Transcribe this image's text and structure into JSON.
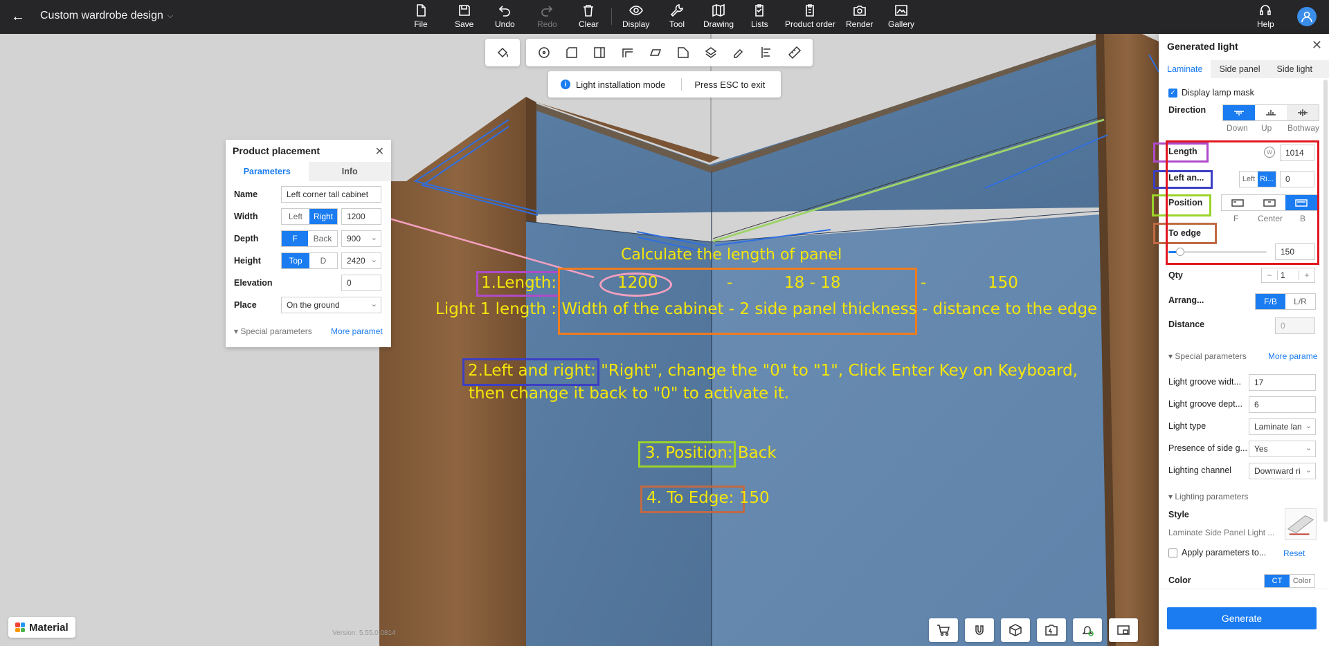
{
  "topbar": {
    "title": "Custom wardrobe design",
    "tools": [
      {
        "label": "File"
      },
      {
        "label": "Save"
      },
      {
        "label": "Undo"
      },
      {
        "label": "Redo"
      },
      {
        "label": "Clear"
      },
      {
        "label": "Display"
      },
      {
        "label": "Tool"
      },
      {
        "label": "Drawing"
      },
      {
        "label": "Lists"
      },
      {
        "label": "Product order"
      },
      {
        "label": "Render"
      },
      {
        "label": "Gallery"
      }
    ],
    "help": "Help"
  },
  "banner": {
    "mode": "Light installation mode",
    "exit": "Press ESC to exit"
  },
  "annotations": {
    "heading": "Calculate the length of panel",
    "step1": "1.Length:",
    "v1": "1200",
    "m1": "-",
    "v2": "18 - 18",
    "m2": "-",
    "v3": "150",
    "formula_a": "Light 1 length : ",
    "formula_b": "Width of the cabinet - 2 side panel thickness",
    "formula_c": " - distance to the edge",
    "step2": "2.Left and right:",
    "step2_text": " \"Right\", change the \"0\" to \"1\", Click Enter Key on Keyboard,",
    "step2_text2": "then change it back to \"0\" to activate it.",
    "step3": "3. Position:",
    "step3_val": " Back",
    "step4": "4. To Edge:",
    "step4_val": " 150"
  },
  "product_placement": {
    "title": "Product placement",
    "tabs": [
      "Parameters",
      "Info"
    ],
    "name_label": "Name",
    "name_value": "Left corner tall cabinet",
    "width_label": "Width",
    "width_opts": [
      "Left",
      "Right"
    ],
    "width_value": "1200",
    "depth_label": "Depth",
    "depth_opts": [
      "F",
      "Back"
    ],
    "depth_value": "900",
    "height_label": "Height",
    "height_opts": [
      "Top",
      "D"
    ],
    "height_value": "2420",
    "elevation_label": "Elevation",
    "elevation_value": "0",
    "place_label": "Place",
    "place_value": "On the ground",
    "special": "Special parameters",
    "more": "More paramet"
  },
  "generated_light": {
    "title": "Generated light",
    "tabs": [
      "Laminate",
      "Side panel",
      "Side light"
    ],
    "display_mask": "Display lamp mask",
    "direction": "Direction",
    "dir_opts": [
      "Down",
      "Up",
      "Bothway"
    ],
    "length": "Length",
    "length_value": "1014",
    "left_right": "Left an...",
    "lr_opts": [
      "Left",
      "Ri..."
    ],
    "lr_value": "0",
    "position": "Position",
    "pos_opts": [
      "F",
      "Center",
      "B"
    ],
    "to_edge": "To edge",
    "to_edge_value": "150",
    "to_edge_fraction": 0.12,
    "qty": "Qty",
    "qty_value": "1",
    "arrange": "Arrang...",
    "arrange_opts": [
      "F/B",
      "L/R"
    ],
    "distance": "Distance",
    "distance_value": "0",
    "special": "Special parameters",
    "more": "More parame",
    "groove_width": "Light groove widt...",
    "groove_width_value": "17",
    "groove_depth": "Light groove dept...",
    "groove_depth_value": "6",
    "light_type": "Light type",
    "light_type_value": "Laminate lan",
    "side_g": "Presence of side g...",
    "side_g_value": "Yes",
    "channel": "Lighting channel",
    "channel_value": "Downward ri",
    "lighting_params": "Lighting parameters",
    "style": "Style",
    "style_value": "Laminate Side Panel Light ...",
    "apply": "Apply parameters to...",
    "reset": "Reset",
    "color": "Color",
    "color_opts": [
      "CT",
      "Color"
    ],
    "generate": "Generate"
  },
  "bottom": {
    "material": "Material",
    "version": "Version: 5.55.0.0814"
  },
  "colors": {
    "accent": "#1a7cf0",
    "annotation": "#f5e60a",
    "topbar": "#262629"
  }
}
